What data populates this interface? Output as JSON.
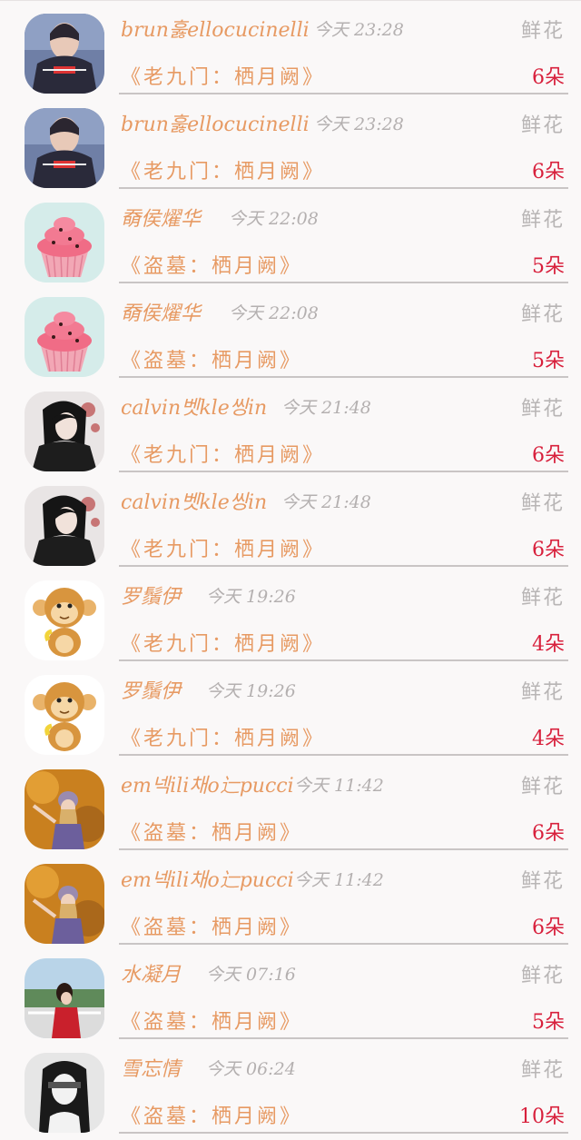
{
  "flower_label": "鲜花",
  "rows": [
    {
      "user": "brun훓ellocucinelli",
      "time": "今天 23:28",
      "item": "《老九门：栖月阙》",
      "count": "6朵",
      "avatar": "hoodie-person"
    },
    {
      "user": "brun훓ellocucinelli",
      "time": "今天 23:28",
      "item": "《老九门：栖月阙》",
      "count": "6朵",
      "avatar": "hoodie-person"
    },
    {
      "user": "奣侯燿华",
      "time": "今天 22:08",
      "item": "《盗墓：栖月阙》",
      "count": "5朵",
      "avatar": "cupcake"
    },
    {
      "user": "奣侯燿华",
      "time": "今天 22:08",
      "item": "《盗墓：栖月阙》",
      "count": "5朵",
      "avatar": "cupcake"
    },
    {
      "user": "calvin벳kle씽in",
      "time": "今天 21:48",
      "item": "《老九门：栖月阙》",
      "count": "6朵",
      "avatar": "dark-anime"
    },
    {
      "user": "calvin벳kle씽in",
      "time": "今天 21:48",
      "item": "《老九门：栖月阙》",
      "count": "6朵",
      "avatar": "dark-anime"
    },
    {
      "user": "罗鬚伊",
      "time": "今天 19:26",
      "item": "《老九门：栖月阙》",
      "count": "4朵",
      "avatar": "monkey"
    },
    {
      "user": "罗鬚伊",
      "time": "今天 19:26",
      "item": "《老九门：栖月阙》",
      "count": "4朵",
      "avatar": "monkey"
    },
    {
      "user": "em넥ili채o辷pucci",
      "time": "今天 11:42",
      "item": "《盗墓：栖月阙》",
      "count": "6朵",
      "avatar": "autumn-girl"
    },
    {
      "user": "em넥ili채o辷pucci",
      "time": "今天 11:42",
      "item": "《盗墓：栖月阙》",
      "count": "6朵",
      "avatar": "autumn-girl"
    },
    {
      "user": "水凝月",
      "time": "今天 07:16",
      "item": "《盗墓：栖月阙》",
      "count": "5朵",
      "avatar": "girl-red"
    },
    {
      "user": "雪忘情",
      "time": "今天 06:24",
      "item": "《盗墓：栖月阙》",
      "count": "10朵",
      "avatar": "bw-girl"
    }
  ]
}
